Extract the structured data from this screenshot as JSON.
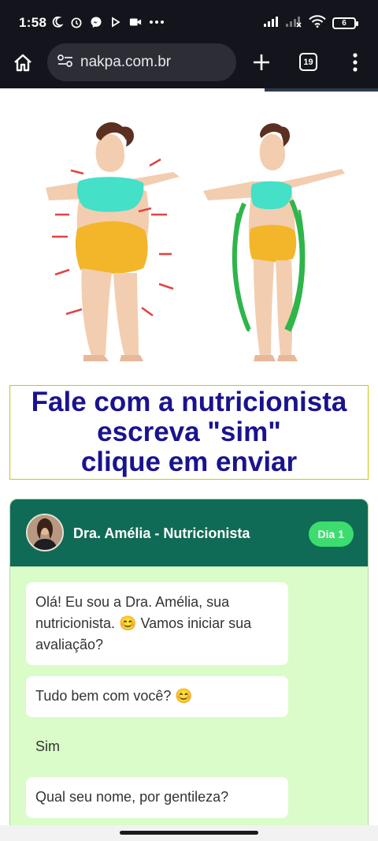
{
  "status_bar": {
    "time": "1:58",
    "battery": "6",
    "left_icons": [
      "moon-icon",
      "alarm-icon",
      "messenger-icon",
      "play-icon",
      "video-icon",
      "more-dots-icon"
    ],
    "right_icons": [
      "signal-icon",
      "signal-2-icon",
      "wifi-icon",
      "battery-icon"
    ]
  },
  "browser": {
    "url": "nakpa.com.br",
    "tab_count": "19",
    "load_progress_fraction": 0.3
  },
  "headline": {
    "lines": [
      "Fale com a nutricionista",
      "escreva \"sim\"",
      "clique em enviar"
    ],
    "color": "#1a138f"
  },
  "chat": {
    "title": "Dra. Amélia - Nutricionista",
    "day_badge": "Dia 1",
    "header_color": "#0f6b55",
    "messages": [
      {
        "from": "bot",
        "text": "Olá! Eu sou a Dra. Amélia, sua nutricionista. 😊 Vamos iniciar sua avaliação?"
      },
      {
        "from": "bot",
        "text": "Tudo bem com você? 😊"
      },
      {
        "from": "user",
        "text": "Sim"
      },
      {
        "from": "bot",
        "text": "Qual seu nome, por gentileza?"
      }
    ]
  }
}
